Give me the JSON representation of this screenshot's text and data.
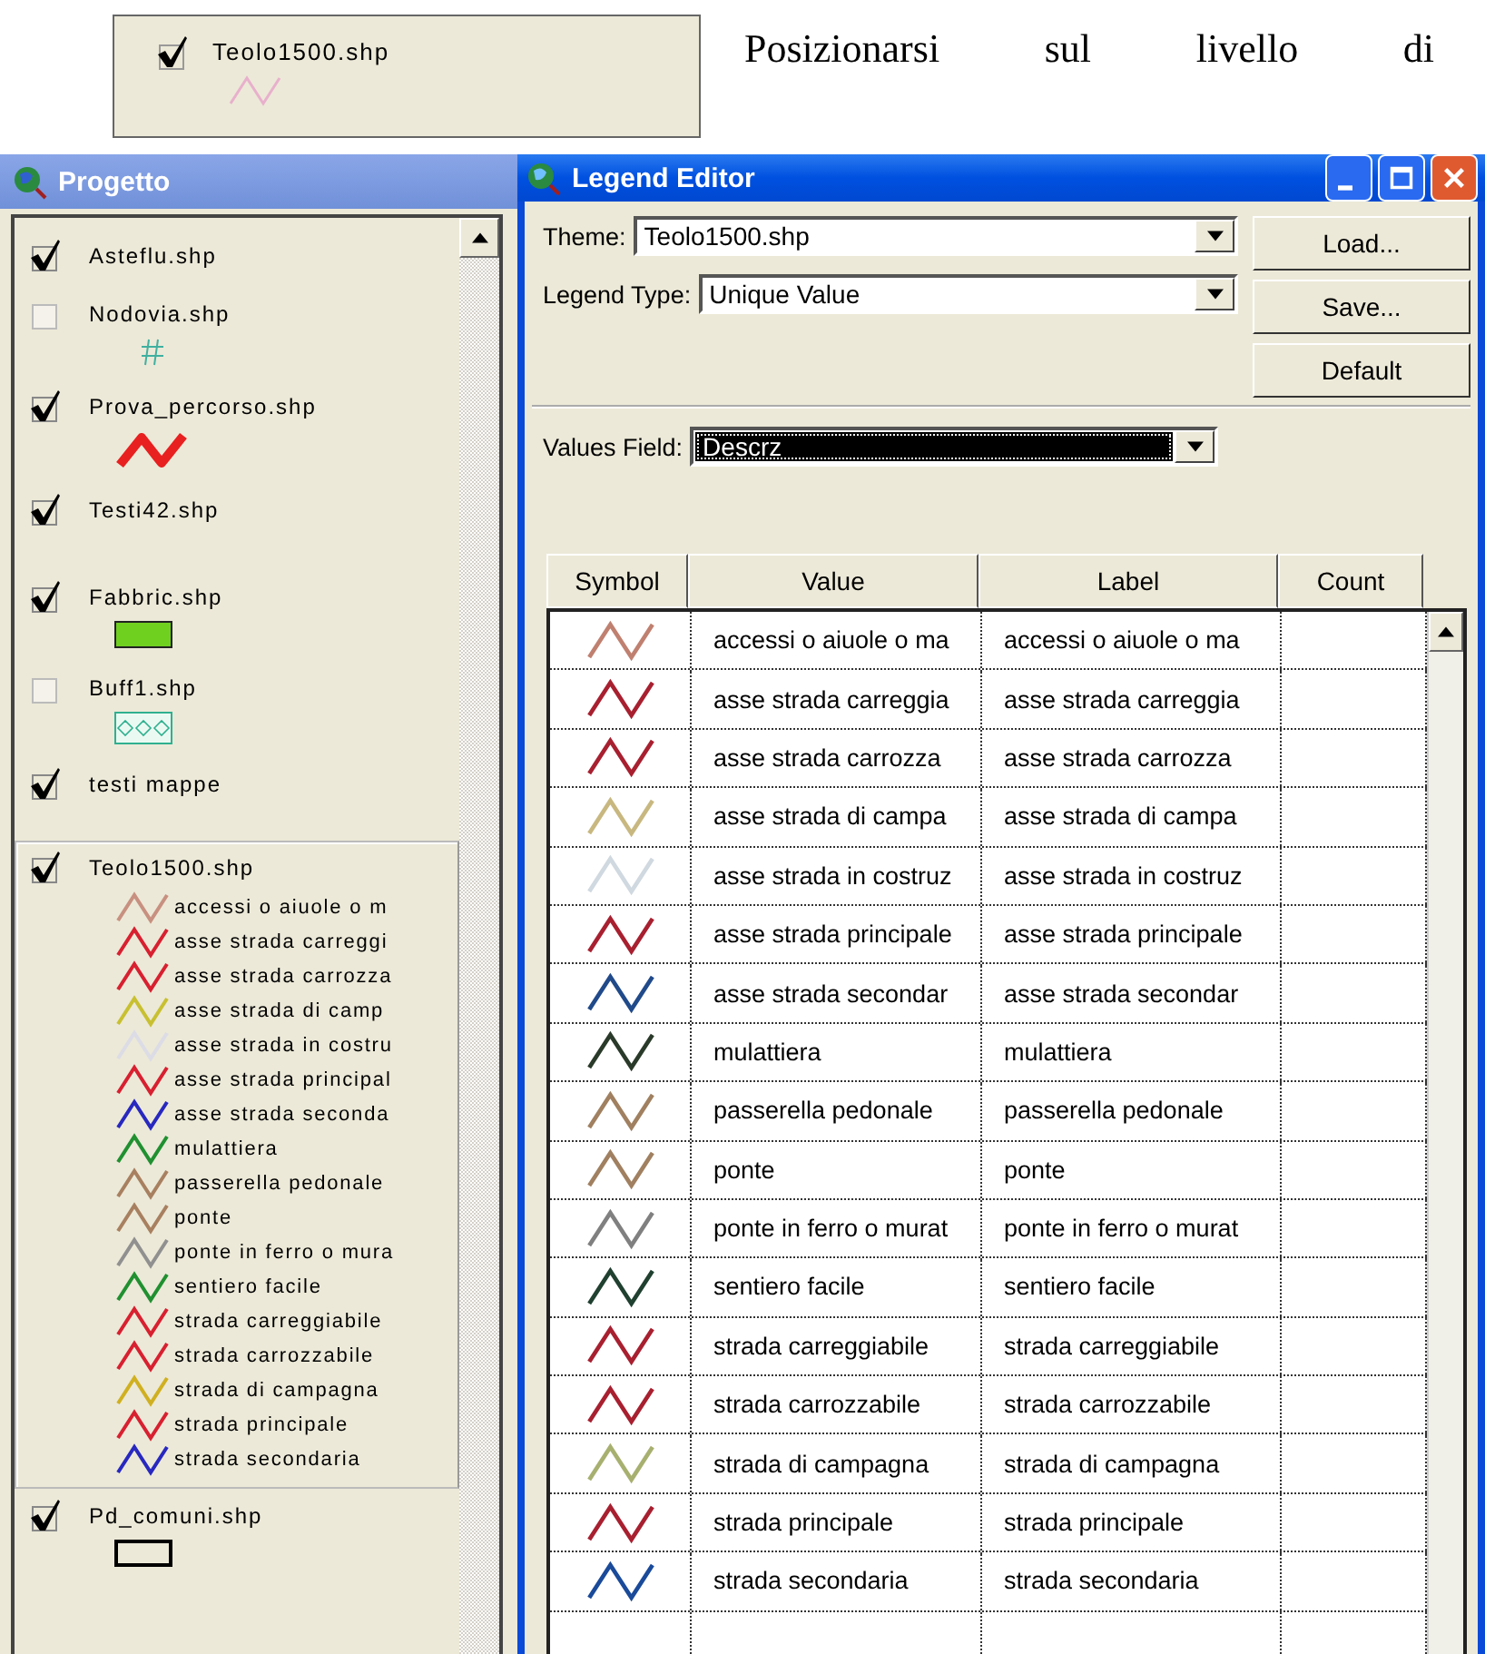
{
  "inset": {
    "checked": true,
    "name": "Teolo1500.shp"
  },
  "caption": "Posizionarsi sul livello di",
  "project": {
    "title": "Progetto",
    "themes": [
      {
        "name": "Asteflu.shp",
        "checked": true,
        "selected": false,
        "kind": "none"
      },
      {
        "name": "Nodovia.shp",
        "checked": false,
        "selected": false,
        "kind": "marker",
        "color": "#40b0a0"
      },
      {
        "name": "Prova_percorso.shp",
        "checked": true,
        "selected": false,
        "kind": "line",
        "color": "#e82020"
      },
      {
        "name": "Testi42.shp",
        "checked": true,
        "selected": false,
        "kind": "none"
      },
      {
        "name": "Fabbric.shp",
        "checked": true,
        "selected": false,
        "kind": "fill",
        "color": "#70d020"
      },
      {
        "name": "Buff1.shp",
        "checked": false,
        "selected": false,
        "kind": "pattern",
        "color": "#30b090"
      },
      {
        "name": "testi mappe",
        "checked": true,
        "selected": false,
        "kind": "none"
      },
      {
        "name": "Teolo1500.shp",
        "checked": true,
        "selected": true,
        "kind": "classes",
        "classes": [
          {
            "label": "accessi o aiuole o m",
            "color": "#c89080"
          },
          {
            "label": "asse strada carreggi",
            "color": "#d82030"
          },
          {
            "label": "asse strada carrozza",
            "color": "#d82030"
          },
          {
            "label": "asse strada di camp",
            "color": "#c8c030"
          },
          {
            "label": "asse strada in costru",
            "color": "#dcdce6"
          },
          {
            "label": "asse strada principal",
            "color": "#d82030"
          },
          {
            "label": "asse strada seconda",
            "color": "#2828c0"
          },
          {
            "label": "mulattiera",
            "color": "#209030"
          },
          {
            "label": "passerella pedonale",
            "color": "#a88060"
          },
          {
            "label": "ponte",
            "color": "#a88060"
          },
          {
            "label": "ponte in ferro o mura",
            "color": "#909090"
          },
          {
            "label": "sentiero facile",
            "color": "#209030"
          },
          {
            "label": "strada carreggiabile",
            "color": "#d82030"
          },
          {
            "label": "strada carrozzabile",
            "color": "#d82030"
          },
          {
            "label": "strada di campagna",
            "color": "#d0b020"
          },
          {
            "label": "strada principale",
            "color": "#d82030"
          },
          {
            "label": "strada secondaria",
            "color": "#2828c0"
          }
        ]
      },
      {
        "name": "Pd_comuni.shp",
        "checked": true,
        "selected": false,
        "kind": "outline",
        "color": "#000000"
      }
    ]
  },
  "legend_editor": {
    "title": "Legend Editor",
    "theme": {
      "label": "Theme:",
      "value": "Teolo1500.shp"
    },
    "legend_type": {
      "label": "Legend Type:",
      "value": "Unique Value"
    },
    "buttons": [
      "Load...",
      "Save...",
      "Default"
    ],
    "values_field": {
      "label": "Values Field:",
      "value": "Descrz",
      "focused": true
    },
    "columns": [
      "Symbol",
      "Value",
      "Label",
      "Count"
    ],
    "rows": [
      {
        "value": "accessi o aiuole o ma",
        "label": "accessi o aiuole o ma",
        "color": "#c08070"
      },
      {
        "value": "asse strada carreggia",
        "label": "asse strada carreggia",
        "color": "#a82030"
      },
      {
        "value": "asse strada carrozza",
        "label": "asse strada carrozza",
        "color": "#a82030"
      },
      {
        "value": "asse strada di campa",
        "label": "asse strada di campa",
        "color": "#c8b880"
      },
      {
        "value": "asse strada in costruz",
        "label": "asse strada in costruz",
        "color": "#d0d8e0"
      },
      {
        "value": "asse strada principale",
        "label": "asse strada principale",
        "color": "#a82030"
      },
      {
        "value": "asse strada secondar",
        "label": "asse strada secondar",
        "color": "#204a8a"
      },
      {
        "value": "mulattiera",
        "label": "mulattiera",
        "color": "#2a3a2a"
      },
      {
        "value": "passerella pedonale",
        "label": "passerella pedonale",
        "color": "#a08060"
      },
      {
        "value": "ponte",
        "label": "ponte",
        "color": "#a08060"
      },
      {
        "value": "ponte in ferro o murat",
        "label": "ponte in ferro o murat",
        "color": "#808080"
      },
      {
        "value": "sentiero facile",
        "label": "sentiero facile",
        "color": "#204030"
      },
      {
        "value": "strada carreggiabile",
        "label": "strada carreggiabile",
        "color": "#a82030"
      },
      {
        "value": "strada carrozzabile",
        "label": "strada carrozzabile",
        "color": "#a82030"
      },
      {
        "value": "strada di campagna",
        "label": "strada di campagna",
        "color": "#a8b070"
      },
      {
        "value": "strada principale",
        "label": "strada principale",
        "color": "#a82030"
      },
      {
        "value": "strada secondaria",
        "label": "strada secondaria",
        "color": "#1a4a9a"
      }
    ]
  }
}
